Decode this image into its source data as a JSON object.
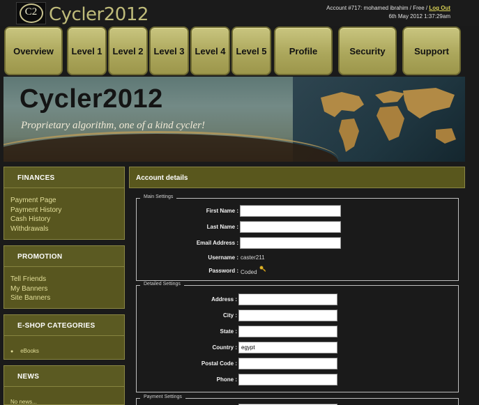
{
  "header": {
    "logo_text": "C2",
    "site_title": "Cycler2012",
    "account_text": "Account #717: mohamed ibrahim / Free / ",
    "logout_label": "Log Out",
    "datetime": "6th May 2012 1:37:29am"
  },
  "nav": [
    "Overview",
    "Level 1",
    "Level 2",
    "Level 3",
    "Level 4",
    "Level 5",
    "Profile",
    "Security",
    "Support"
  ],
  "banner": {
    "title": "Cycler2012",
    "tagline": "Proprietary algorithm, one of a kind cycler!"
  },
  "sidebar": {
    "finances": {
      "title": "FINANCES",
      "links": [
        "Payment Page",
        "Payment History",
        "Cash History",
        "Withdrawals"
      ]
    },
    "promotion": {
      "title": "PROMOTION",
      "links": [
        "Tell Friends",
        "My Banners",
        "Site Banners"
      ]
    },
    "eshop": {
      "title": "E-SHOP CATEGORIES",
      "items": [
        "eBooks"
      ]
    },
    "news": {
      "title": "NEWS",
      "text": "No news..."
    }
  },
  "main": {
    "title": "Account details",
    "main_settings": {
      "legend": "Main Settings",
      "first_name_label": "First Name :",
      "first_name_value": "",
      "last_name_label": "Last Name :",
      "last_name_value": "",
      "email_label": "Email Address :",
      "email_value": "",
      "username_label": "Username :",
      "username_value": "caster211",
      "password_label": "Password :",
      "password_value": "Coded"
    },
    "detailed_settings": {
      "legend": "Detailed Settings",
      "address_label": "Address :",
      "address_value": "",
      "city_label": "City :",
      "city_value": "",
      "state_label": "State :",
      "state_value": "",
      "country_label": "Country :",
      "country_value": "egypt",
      "postal_label": "Postal Code :",
      "postal_value": "",
      "phone_label": "Phone :",
      "phone_value": ""
    },
    "payment_settings": {
      "legend": "Payment Settings"
    }
  },
  "colors": {
    "nav_button": "#aca75c",
    "panel_olive": "#58561f",
    "link_text": "#e3df9a",
    "logout": "#d7cf55"
  }
}
